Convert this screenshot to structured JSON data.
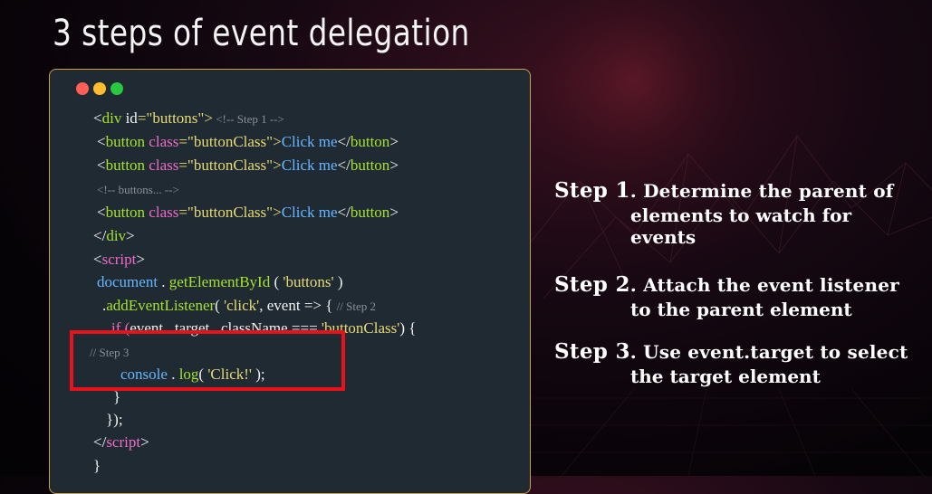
{
  "title": "3 steps of event delegation",
  "code_lines": [
    {
      "parts": [
        {
          "t": "<",
          "c": "white"
        },
        {
          "t": "div",
          "c": "green"
        },
        {
          "t": " id",
          "c": "white"
        },
        {
          "t": "=\"buttons\">",
          "c": "yellow"
        },
        {
          "t": " <!-- Step 1 -->",
          "c": "comment"
        }
      ]
    },
    {
      "parts": [
        {
          "t": "<",
          "c": "white"
        },
        {
          "t": "button",
          "c": "green"
        },
        {
          "t": " class",
          "c": "pink"
        },
        {
          "t": "=\"buttonClass\">",
          "c": "yellow"
        },
        {
          "t": "Click me",
          "c": "blue"
        },
        {
          "t": "</",
          "c": "white"
        },
        {
          "t": "button",
          "c": "green"
        },
        {
          "t": ">",
          "c": "white"
        }
      ]
    },
    {
      "parts": [
        {
          "t": "<",
          "c": "white"
        },
        {
          "t": "button",
          "c": "green"
        },
        {
          "t": " class",
          "c": "pink"
        },
        {
          "t": "=\"buttonClass\">",
          "c": "yellow"
        },
        {
          "t": "Click me",
          "c": "blue"
        },
        {
          "t": "</",
          "c": "white"
        },
        {
          "t": "button",
          "c": "green"
        },
        {
          "t": ">",
          "c": "white"
        }
      ]
    },
    {
      "parts": [
        {
          "t": "<!-- buttons... -->",
          "c": "comment"
        }
      ]
    },
    {
      "parts": [
        {
          "t": "<",
          "c": "white"
        },
        {
          "t": "button",
          "c": "green"
        },
        {
          "t": " class",
          "c": "pink"
        },
        {
          "t": "=\"buttonClass\">",
          "c": "yellow"
        },
        {
          "t": "Click me",
          "c": "blue"
        },
        {
          "t": "</",
          "c": "white"
        },
        {
          "t": "button",
          "c": "green"
        },
        {
          "t": ">",
          "c": "white"
        }
      ]
    },
    {
      "parts": [
        {
          "t": "</",
          "c": "white"
        },
        {
          "t": "div",
          "c": "green"
        },
        {
          "t": ">",
          "c": "white"
        }
      ]
    },
    {
      "parts": [
        {
          "t": "<",
          "c": "white"
        },
        {
          "t": "script",
          "c": "pink"
        },
        {
          "t": ">",
          "c": "white"
        }
      ]
    },
    {
      "parts": [
        {
          "t": "document",
          "c": "blue"
        },
        {
          "t": " . ",
          "c": "white"
        },
        {
          "t": "getElementById",
          "c": "green"
        },
        {
          "t": " ( ",
          "c": "white"
        },
        {
          "t": "'buttons'",
          "c": "yellow"
        },
        {
          "t": " )",
          "c": "white"
        }
      ]
    },
    {
      "parts": [
        {
          "t": ".",
          "c": "white"
        },
        {
          "t": "addEventListener",
          "c": "green"
        },
        {
          "t": "( ",
          "c": "white"
        },
        {
          "t": "'click'",
          "c": "yellow"
        },
        {
          "t": ", event => { ",
          "c": "white"
        },
        {
          "t": "// Step 2",
          "c": "comment"
        }
      ]
    },
    {
      "parts": [
        {
          "t": "if (",
          "c": "pink"
        },
        {
          "t": "event . target . className",
          "c": "white"
        },
        {
          "t": " === ",
          "c": "white"
        },
        {
          "t": "'buttonClass'",
          "c": "yellow"
        },
        {
          "t": ") {",
          "c": "white"
        }
      ]
    },
    {
      "parts": [
        {
          "t": "// Step 3",
          "c": "comment"
        }
      ]
    },
    {
      "parts": [
        {
          "t": "console",
          "c": "blue"
        },
        {
          "t": " . ",
          "c": "white"
        },
        {
          "t": "log",
          "c": "green"
        },
        {
          "t": "( ",
          "c": "white"
        },
        {
          "t": "'Click!'",
          "c": "yellow"
        },
        {
          "t": " );",
          "c": "white"
        }
      ]
    },
    {
      "parts": [
        {
          "t": "}",
          "c": "white"
        }
      ]
    },
    {
      "parts": [
        {
          "t": "});",
          "c": "white"
        }
      ]
    },
    {
      "parts": [
        {
          "t": "</",
          "c": "white"
        },
        {
          "t": "script",
          "c": "pink"
        },
        {
          "t": ">",
          "c": "white"
        }
      ]
    },
    {
      "parts": [
        {
          "t": "}",
          "c": "white"
        }
      ]
    }
  ],
  "steps": [
    {
      "label": "Step 1",
      "lines": [
        ". Determine the parent of",
        "elements to watch for",
        "events"
      ]
    },
    {
      "label": "Step 2",
      "lines": [
        ". Attach the event listener",
        "to the  parent element"
      ]
    },
    {
      "label": "Step 3",
      "lines": [
        ". Use event.target to select",
        "the target element"
      ]
    }
  ],
  "colors": {
    "highlight": "#e8131a",
    "window_border": "#c9a24a",
    "window_bg": "#1f2a33"
  }
}
